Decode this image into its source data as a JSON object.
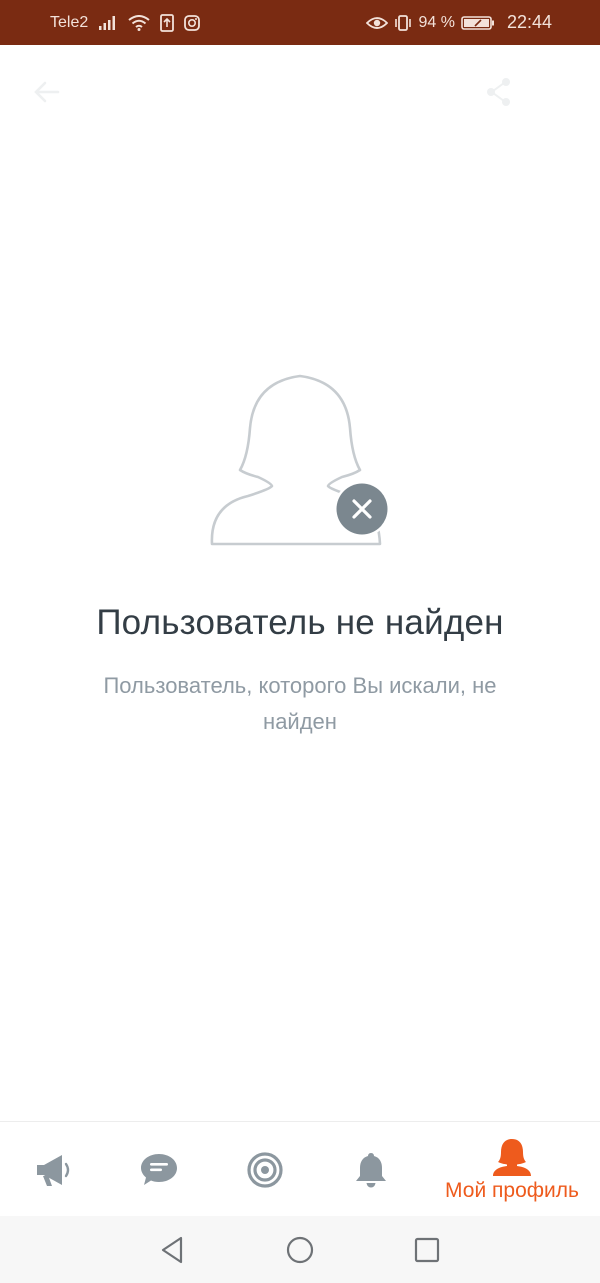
{
  "status_bar": {
    "carrier": "Tele2",
    "battery": "94 %",
    "time": "22:44"
  },
  "empty_state": {
    "title": "Пользователь не найден",
    "subtitle": "Пользователь, которого Вы искали, не найден"
  },
  "bottom_nav": {
    "items": [
      {
        "icon": "megaphone-icon"
      },
      {
        "icon": "chat-icon"
      },
      {
        "icon": "target-icon"
      },
      {
        "icon": "bell-icon"
      },
      {
        "icon": "profile-icon",
        "label": "Мой профиль",
        "active": true
      }
    ]
  },
  "colors": {
    "status_bar": "#7a2b12",
    "accent": "#ee5b1d",
    "icon_gray": "#8c979f",
    "title": "#333d45",
    "subtitle": "#8f9aa3"
  }
}
